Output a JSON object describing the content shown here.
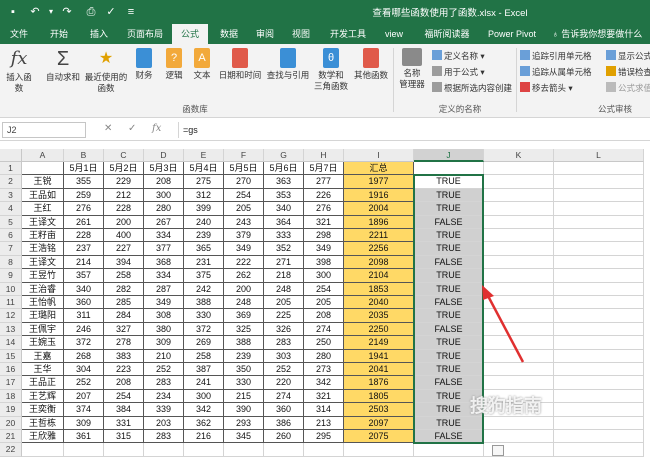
{
  "window": {
    "title": "查看哪些函数使用了函数.xlsx - Excel"
  },
  "ribbon_tabs": [
    "文件",
    "开始",
    "插入",
    "页面布局",
    "公式",
    "数据",
    "审阅",
    "视图",
    "开发工具",
    "view",
    "福昕阅读器",
    "Power Pivot"
  ],
  "active_tab": "公式",
  "tell_me": "告诉我你想要做什么",
  "function_library": {
    "insert_function": "插入函数",
    "autosum": "自动求和",
    "recent_1": "最近使用的",
    "recent_2": "函数",
    "financial": "财务",
    "logical": "逻辑",
    "text": "文本",
    "datetime": "日期和时间",
    "lookup": "查找与引用",
    "math_1": "数学和",
    "math_2": "三角函数",
    "more": "其他函数",
    "group_label": "函数库"
  },
  "defined_names": {
    "name_manager_1": "名称",
    "name_manager_2": "管理器",
    "define_name": "定义名称",
    "use_in_formula": "用于公式",
    "create_from_selection": "根据所选内容创建",
    "group_label": "定义的名称"
  },
  "formula_auditing": {
    "trace_precedents": "追踪引用单元格",
    "trace_dependents": "追踪从属单元格",
    "remove_arrows": "移去箭头",
    "show_formulas": "显示公式",
    "error_checking": "错误检查",
    "evaluate_formula": "公式求值",
    "group_label": "公式审核"
  },
  "formula_bar": {
    "name_box": "J2",
    "formula": "=gs"
  },
  "columns": [
    "A",
    "B",
    "C",
    "D",
    "E",
    "F",
    "G",
    "H",
    "I",
    "J",
    "K",
    "L"
  ],
  "header_row": [
    "",
    "5月1日",
    "5月2日",
    "5月3日",
    "5月4日",
    "5月5日",
    "5月6日",
    "5月7日",
    "汇总",
    ""
  ],
  "rows": [
    {
      "name": "王锐",
      "v": [
        355,
        229,
        208,
        275,
        270,
        363,
        277
      ],
      "sum": 1977,
      "tf": "TRUE"
    },
    {
      "name": "王品如",
      "v": [
        259,
        212,
        300,
        312,
        254,
        353,
        226
      ],
      "sum": 1916,
      "tf": "TRUE"
    },
    {
      "name": "王红",
      "v": [
        276,
        228,
        280,
        399,
        205,
        340,
        276
      ],
      "sum": 2004,
      "tf": "TRUE"
    },
    {
      "name": "王译文",
      "v": [
        261,
        200,
        267,
        240,
        243,
        364,
        321
      ],
      "sum": 1896,
      "tf": "FALSE"
    },
    {
      "name": "王籽亩",
      "v": [
        228,
        400,
        334,
        239,
        379,
        333,
        298
      ],
      "sum": 2211,
      "tf": "TRUE"
    },
    {
      "name": "王浩铭",
      "v": [
        237,
        227,
        377,
        365,
        349,
        352,
        349
      ],
      "sum": 2256,
      "tf": "TRUE"
    },
    {
      "name": "王译文",
      "v": [
        214,
        394,
        368,
        231,
        222,
        271,
        398
      ],
      "sum": 2098,
      "tf": "FALSE"
    },
    {
      "name": "王昱竹",
      "v": [
        357,
        258,
        334,
        375,
        262,
        218,
        300
      ],
      "sum": 2104,
      "tf": "TRUE"
    },
    {
      "name": "王治睿",
      "v": [
        340,
        282,
        287,
        242,
        200,
        248,
        254
      ],
      "sum": 1853,
      "tf": "TRUE"
    },
    {
      "name": "王怡帆",
      "v": [
        360,
        285,
        349,
        388,
        248,
        205,
        205
      ],
      "sum": 2040,
      "tf": "FALSE"
    },
    {
      "name": "王璐阳",
      "v": [
        311,
        284,
        308,
        330,
        369,
        225,
        208
      ],
      "sum": 2035,
      "tf": "TRUE"
    },
    {
      "name": "王佩宇",
      "v": [
        246,
        327,
        380,
        372,
        325,
        326,
        274
      ],
      "sum": 2250,
      "tf": "FALSE"
    },
    {
      "name": "王婉玉",
      "v": [
        372,
        278,
        309,
        269,
        388,
        283,
        250
      ],
      "sum": 2149,
      "tf": "TRUE"
    },
    {
      "name": "王嘉",
      "v": [
        268,
        383,
        210,
        258,
        239,
        303,
        280
      ],
      "sum": 1941,
      "tf": "TRUE"
    },
    {
      "name": "王华",
      "v": [
        304,
        223,
        252,
        387,
        350,
        252,
        273
      ],
      "sum": 2041,
      "tf": "TRUE"
    },
    {
      "name": "王品正",
      "v": [
        252,
        208,
        283,
        241,
        330,
        220,
        342
      ],
      "sum": 1876,
      "tf": "FALSE"
    },
    {
      "name": "王艺辉",
      "v": [
        207,
        254,
        234,
        300,
        215,
        274,
        321
      ],
      "sum": 1805,
      "tf": "TRUE"
    },
    {
      "name": "王奕衡",
      "v": [
        374,
        384,
        339,
        342,
        390,
        360,
        314
      ],
      "sum": 2503,
      "tf": "TRUE"
    },
    {
      "name": "王哲栋",
      "v": [
        309,
        331,
        203,
        362,
        293,
        386,
        213
      ],
      "sum": 2097,
      "tf": "TRUE"
    },
    {
      "name": "王欣雅",
      "v": [
        361,
        315,
        283,
        216,
        345,
        260,
        295
      ],
      "sum": 2075,
      "tf": "FALSE"
    }
  ],
  "watermark": "搜狗指南",
  "colors": {
    "excel_green": "#217346",
    "sum_fill": "#ffd966",
    "selection_fill": "#d0d0d0",
    "arrow": "#e03030"
  }
}
